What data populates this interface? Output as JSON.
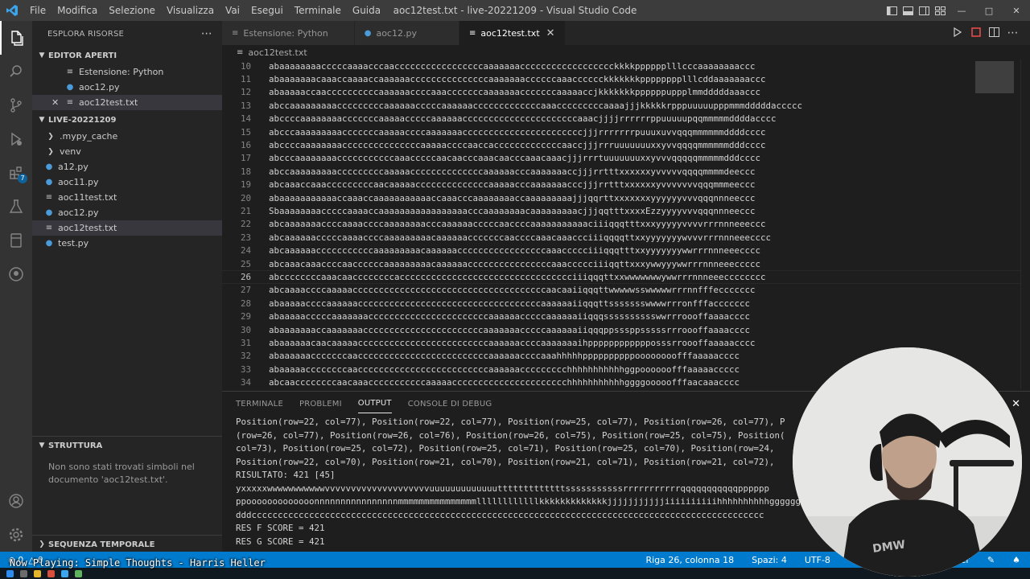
{
  "app": {
    "title": "aoc12test.txt - live-20221209 - Visual Studio Code",
    "menu": [
      "File",
      "Modifica",
      "Selezione",
      "Visualizza",
      "Vai",
      "Esegui",
      "Terminale",
      "Guida"
    ],
    "accent": "#007acc"
  },
  "activity": {
    "items": [
      "explorer-icon",
      "search-icon",
      "source-control-icon",
      "run-debug-icon",
      "extensions-icon",
      "testing-icon",
      "remote-icon",
      "github-icon"
    ],
    "extensions_badge": "7"
  },
  "sidebar": {
    "header": "ESPLORA RISORSE",
    "open_editors": {
      "title": "EDITOR APERTI",
      "items": [
        {
          "label": "Estensione: Python",
          "icon": "extension-icon"
        },
        {
          "label": "aoc12.py",
          "icon": "python-file-icon"
        },
        {
          "label": "aoc12test.txt",
          "icon": "text-file-icon"
        }
      ]
    },
    "workspace": {
      "title": "LIVE-20221209",
      "items": [
        {
          "label": ".mypy_cache",
          "type": "folder"
        },
        {
          "label": "venv",
          "type": "folder"
        },
        {
          "label": "a12.py",
          "type": "py"
        },
        {
          "label": "aoc11.py",
          "type": "py"
        },
        {
          "label": "aoc11test.txt",
          "type": "txt"
        },
        {
          "label": "aoc12.py",
          "type": "py"
        },
        {
          "label": "aoc12test.txt",
          "type": "txt"
        },
        {
          "label": "test.py",
          "type": "py"
        }
      ]
    },
    "outline": {
      "title": "STRUTTURA",
      "message": "Non sono stati trovati simboli nel documento 'aoc12test.txt'."
    },
    "timeline": {
      "title": "SEQUENZA TEMPORALE"
    }
  },
  "tabs": [
    {
      "label": "Estensione: Python",
      "icon": "extension-icon"
    },
    {
      "label": "aoc12.py",
      "icon": "python-file-icon"
    },
    {
      "label": "aoc12test.txt",
      "icon": "text-file-icon",
      "active": true
    }
  ],
  "breadcrumb": {
    "file": "aoc12test.txt"
  },
  "editor": {
    "current_line": 26,
    "lines": [
      {
        "n": "10",
        "text": "abaaaaaaaacccccaaaacccaacccccccccccccccccaaaaaaacccccccccccccccccckkkkpppppplllcccaaaaaaaaccc"
      },
      {
        "n": "11",
        "text": "abaaaaaaacaaaccaaaaccaaaaaacccccccccccccccaaaaaaaccccccaaacccccckkkkkkkpppppppplllcddaaaaaaaccc"
      },
      {
        "n": "12",
        "text": "abaaaaaccaaccccccccccaaaaaaccccaaacccccccaaaaaaacccccccaaaaaccjkkkkkkkppppppuppplmmdddddaaaccc"
      },
      {
        "n": "13",
        "text": "abccaaaaaaaaacccccccccaaaaaacccccaaaaaacccccccccccccaaacccccccccaaaajjjkkkkkrpppuuuuupppmmmdddddaccccc"
      },
      {
        "n": "14",
        "text": "abccccaaaaaaaacccccccaaaaacccccaaaaaaccccccccccccccccccccccaaacjjjjrrrrrrppuuuuupqqmmmmmddddacccc"
      },
      {
        "n": "15",
        "text": "abcccaaaaaaaaacccccccaaaaaccccaaaaaaacccccccccccccccccccccccjjjrrrrrrrpuuuxuvvqqqmmmmmmddddcccc"
      },
      {
        "n": "16",
        "text": "abccccaaaaaaaacccccccccccccccaaaaaccccaaccacccccccccccccaaccjjjrrruuuuuuuxxyvvqqqqmmmmmmdddcccc"
      },
      {
        "n": "17",
        "text": "abcccaaaaaaaacccccccccccaaacccccaacaacccaaacaacccaaacaaacjjjrrrtuuuuuuuxxyvvvqqqqqmmmmmdddcccc"
      },
      {
        "n": "18",
        "text": "abccaaaaaaaaacccccccccaaaaaccccccccccccccaaaaaacccaaaaaaaccjjjrrtttxxxxxxyvvvvvqqqqmmmmdeeccc"
      },
      {
        "n": "19",
        "text": "abcaaaccaaacccccccccaacaaaaaccccccccccccccaaaaacccaaaaaaacccjjjrrtttxxxxxxyvvvvvvvqqqmmmeeccc"
      },
      {
        "n": "20",
        "text": "abaaaaaaaaaaaccaaaccaaaaaaaaaaaccaaacccaaaaaaaaccaaaaaaaaajjjqqrttxxxxxxxyyyyyyvvvqqqnnneeccc"
      },
      {
        "n": "21",
        "text": "SbaaaaaaaacccccaaaaccaaaaaaaaaaaaaaaaacccaaaaaaaacaaaaaaaaacjjjqqtttxxxxEzzyyyyvvvqqqnnneeccc"
      },
      {
        "n": "22",
        "text": "abcaaaaaaaccccaaaaccccaaaaaaaacccaaaaaacccccaaccccaaaaaaaaaaaciiiqqqtttxxxyyyyyvvvvrrrnnneeeccc"
      },
      {
        "n": "23",
        "text": "abcaaaaaacccccaaaaccccaaaaaaaaacaaaaaacccccccaaccccaaacaaaccciiiqqqqttxxyyyyyyywvvvrrrnnneeecccc"
      },
      {
        "n": "24",
        "text": "abcaaaaaacccccccccccaaaaaaaaacaaaaaacccccccccccccccccaaaccccciiiqqqtttxxyyyyyyywwrrrnnneeecccc"
      },
      {
        "n": "25",
        "text": "abcaaacaaaccccaaccccccaaaaaaaaacaaaaaaccccccccccccccccaaaccccciiiqqttxxxywwyyywwrrrnnneeeccccc"
      },
      {
        "n": "26",
        "text": "abccccccccaaacaaccccccccaccccccccccccccccccccccccccccccccciiiqqqttxxwwwwwwwywwrrrnnneeecccccccc"
      },
      {
        "n": "27",
        "text": "abcaaaaccccaaaaacccccccccccccccccccccccccccccccccccccaacaaiiqqqttwwwwwsswwwwwrrrnnfffeccccccc"
      },
      {
        "n": "28",
        "text": "abaaaaaccccaaaaaacccccccccccccccccccccccccccccccccccaaaaaaiiqqqttssssssswwwwrrronfffaccccccc"
      },
      {
        "n": "29",
        "text": "abaaaaacccccaaaaaaacccccccccccccccccccccccaaaaaacccccaaaaaaiiqqqsssssssssswwrrroooffaaaacccc"
      },
      {
        "n": "30",
        "text": "abaaaaaaaccaaaaaaacccccccccccccccccccccccaaaaaaacccccaaaaaaiiqqqppsssppsssssrrroooffaaaacccc"
      },
      {
        "n": "31",
        "text": "abaaaaaacaacaaaaacccccccccccccccccccccccccaaaaaaccccaaaaaaaihpppppppppppposssrroooffaaaaacccc"
      },
      {
        "n": "32",
        "text": "abaaaaaacccccccaacccccccccccccccccccccccccaaaaaaccccaaahhhhhppppppppppoooooooofffaaaaacccc"
      },
      {
        "n": "33",
        "text": "abaaaaaccccccccaacccccccccccccccccccccccccaaaaaaccccccccchhhhhhhhhhhggpoooooofffaaaaaccccc"
      },
      {
        "n": "34",
        "text": "abcaaccccccccaacaaacccccccccccaaaaacccccccccccccccccccccchhhhhhhhhhhggggooooofffaacaaacccc"
      }
    ]
  },
  "panel": {
    "tabs": [
      "TERMINALE",
      "PROBLEMI",
      "OUTPUT",
      "CONSOLE DI DEBUG"
    ],
    "active_tab": "OUTPUT",
    "output_lines": [
      "Position(row=22, col=77), Position(row=22, col=77), Position(row=25, col=77), Position(row=26, col=77), P",
      "(row=26, col=77), Position(row=26, col=76), Position(row=26, col=75), Position(row=25, col=75), Position(",
      "col=73), Position(row=25, col=72), Position(row=25, col=71), Position(row=25, col=70), Position(row=24,",
      "Position(row=22, col=70), Position(row=21, col=70), Position(row=21, col=71), Position(row=21, col=72),",
      "RISULTATO: 421 [45]",
      "yxxxxxwwwwwwwwwwwvvvvvvvvvvvvvvvvvvvvuuuuuuuuuuuuutttttttttttttsssssssssssrrrrrrrrrrrqqqqqqqqqqqpppppp",
      "ppooooooooooooonnnnnnnnnnnnnnnnmmmmmmmmmmmmmmmllllllllllllkkkkkkkkkkkkkjjjjjjjjjjjiiiiiiiiiihhhhhhhhhhgggggg",
      "dddcccccccccccccccccccccccccccccccccccccccccccccccccccccccccccccccccccccccccccccccccccccccccccccccccc",
      "RES F SCORE = 421",
      "RES G SCORE = 421"
    ]
  },
  "status": {
    "errors": "0",
    "warnings": "0",
    "position": "Riga 26, colonna 18",
    "spaces": "Spazi: 4",
    "encoding": "UTF-8",
    "formatter": "ttier"
  },
  "overlay": {
    "now_playing": "Now Playing: Simple Thoughts - Harris Heller"
  }
}
